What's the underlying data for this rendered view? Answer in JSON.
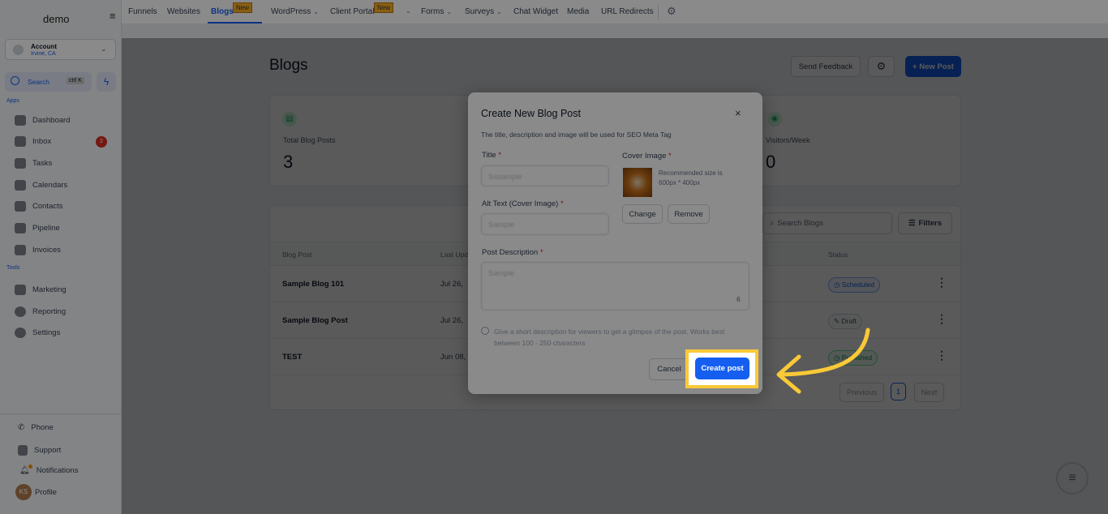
{
  "sidebar": {
    "logo": "demo",
    "account": {
      "name": "Account",
      "location": "Irvine, CA"
    },
    "search": {
      "label": "Search",
      "shortcut": "ctrl K"
    },
    "sections": {
      "apps": "Apps",
      "tools": "Tools"
    },
    "apps": [
      {
        "label": "Dashboard",
        "icon": "dashboard-icon"
      },
      {
        "label": "Inbox",
        "icon": "inbox-icon",
        "badge": "2"
      },
      {
        "label": "Tasks",
        "icon": "tasks-icon"
      },
      {
        "label": "Calendars",
        "icon": "calendar-icon"
      },
      {
        "label": "Contacts",
        "icon": "contacts-icon"
      },
      {
        "label": "Pipeline",
        "icon": "pipeline-icon"
      },
      {
        "label": "Invoices",
        "icon": "invoice-icon"
      }
    ],
    "tools": [
      {
        "label": "Marketing",
        "icon": "megaphone-icon"
      },
      {
        "label": "Reporting",
        "icon": "chart-icon"
      },
      {
        "label": "Settings",
        "icon": "gear-icon"
      }
    ],
    "bottom": [
      {
        "label": "Phone",
        "icon": "phone-icon"
      },
      {
        "label": "Support",
        "icon": "support-icon"
      },
      {
        "label": "Notifications",
        "icon": "bell-icon"
      },
      {
        "label": "Profile",
        "avatar": "KS"
      }
    ]
  },
  "topnav": {
    "items": [
      "Funnels",
      "Websites",
      "Blogs",
      "WordPress",
      "Client Portal",
      "Forms",
      "Surveys",
      "Chat Widget",
      "Media",
      "URL Redirects"
    ],
    "new_badge": "New",
    "active": "Blogs"
  },
  "page": {
    "title": "Blogs",
    "send_feedback": "Send Feedback",
    "new_post": "+ New Post",
    "stats": [
      {
        "label": "Total Blog Posts",
        "value": "3"
      },
      {
        "label": "Visitors/Week",
        "value": "0"
      }
    ],
    "search_placeholder": "Search Blogs",
    "filters": "Filters",
    "columns": [
      "Blog Post",
      "Last Updated",
      "Status"
    ],
    "rows": [
      {
        "title": "Sample Blog 101",
        "date": "Jul 26,",
        "status": "Scheduled"
      },
      {
        "title": "Sample Blog Post",
        "date": "Jul 26,",
        "status": "Draft"
      },
      {
        "title": "TEST",
        "date": "Jun 08,",
        "status": "Published"
      }
    ],
    "pagination": {
      "previous": "Previous",
      "page": "1",
      "next": "Next"
    }
  },
  "modal": {
    "title": "Create New Blog Post",
    "subtitle": "The title, description and image will be used for SEO Meta Tag",
    "title_label": "Title",
    "title_value": "Sssample",
    "alt_label": "Alt Text (Cover Image)",
    "alt_value": "Sample",
    "cover_label": "Cover Image",
    "cover_hint": "Recommended size is 600px * 400px",
    "change": "Change",
    "remove": "Remove",
    "desc_label": "Post Description",
    "desc_value": "Sample",
    "char_count": "6",
    "help": "Give a short description for viewers to get a glimpse of the post. Works best between 100 - 250 characters",
    "cancel": "Cancel",
    "create": "Create post"
  },
  "colors": {
    "accent": "#155eef",
    "highlight": "#f9c937"
  }
}
